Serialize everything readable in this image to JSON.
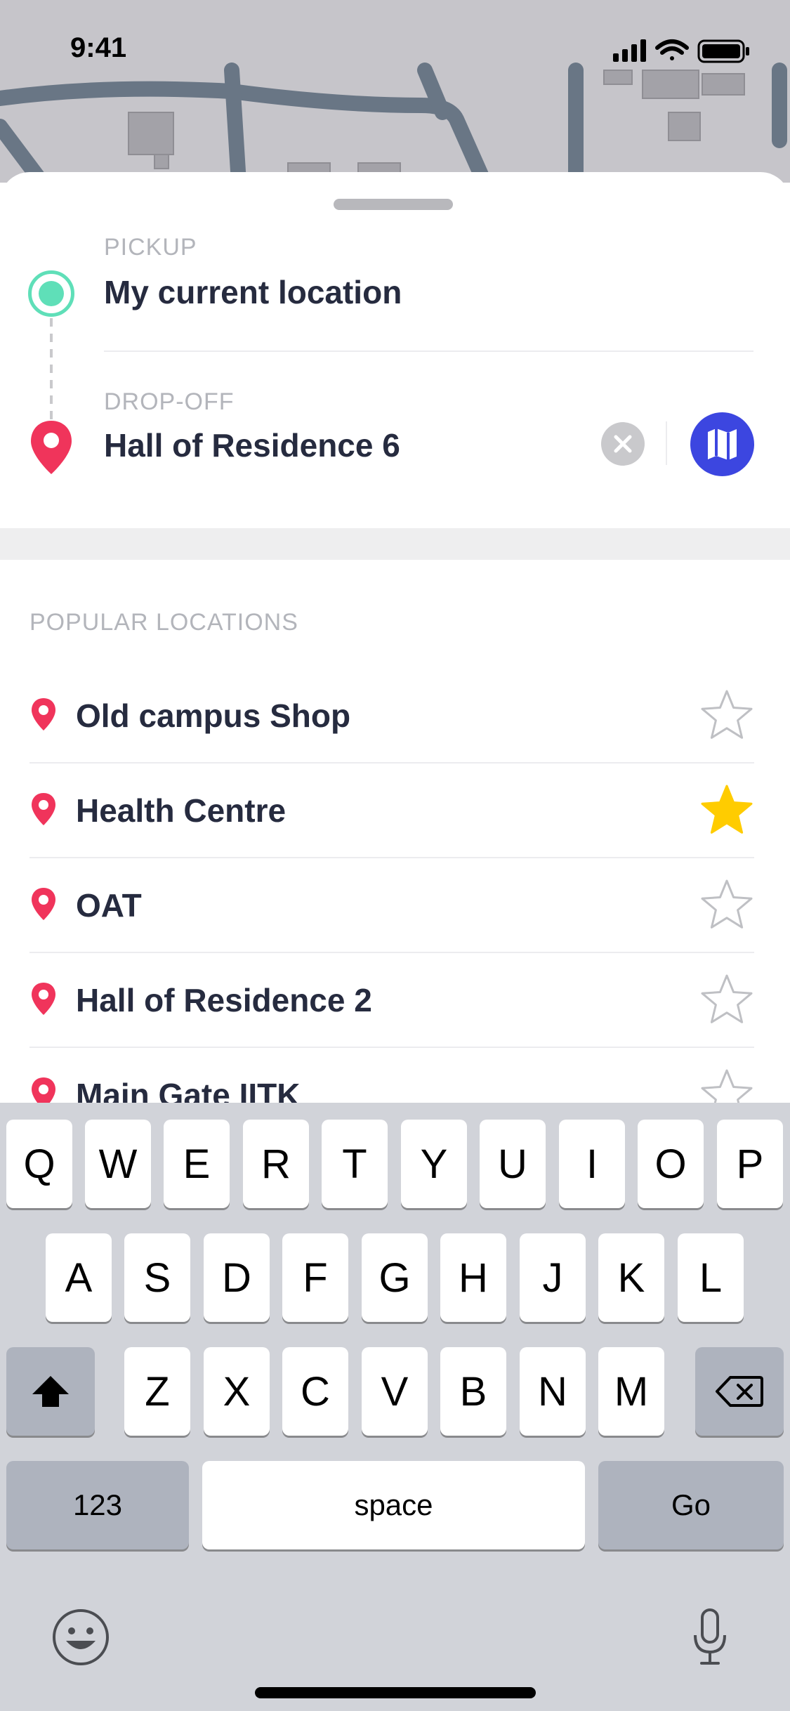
{
  "status_bar": {
    "time": "9:41",
    "icons": [
      "signal-icon",
      "wifi-icon",
      "battery-icon"
    ]
  },
  "route": {
    "pickup": {
      "label": "PICKUP",
      "value": "My current location"
    },
    "dropoff": {
      "label": "DROP-OFF",
      "value": "Hall of Residence 6"
    },
    "icons": {
      "clear": "clear-icon",
      "map": "map-icon"
    }
  },
  "popular": {
    "title": "POPULAR LOCATIONS",
    "items": [
      {
        "name": "Old campus Shop",
        "favorite": false
      },
      {
        "name": "Health Centre",
        "favorite": true
      },
      {
        "name": "OAT",
        "favorite": false
      },
      {
        "name": "Hall of Residence 2",
        "favorite": false
      },
      {
        "name": "Main Gate IITK",
        "favorite": false
      }
    ]
  },
  "keyboard": {
    "row1": [
      "Q",
      "W",
      "E",
      "R",
      "T",
      "Y",
      "U",
      "I",
      "O",
      "P"
    ],
    "row2": [
      "A",
      "S",
      "D",
      "F",
      "G",
      "H",
      "J",
      "K",
      "L"
    ],
    "row3": [
      "Z",
      "X",
      "C",
      "V",
      "B",
      "N",
      "M"
    ],
    "numbers": "123",
    "space": "space",
    "go": "Go",
    "icons": {
      "shift": "shift-icon",
      "delete": "delete-icon",
      "emoji": "emoji-icon",
      "mic": "microphone-icon"
    }
  },
  "colors": {
    "pickup_accent": "#5fdfb8",
    "pin": "#f0345b",
    "map_button": "#3c46e0",
    "favorite_star": "#ffcc00"
  }
}
